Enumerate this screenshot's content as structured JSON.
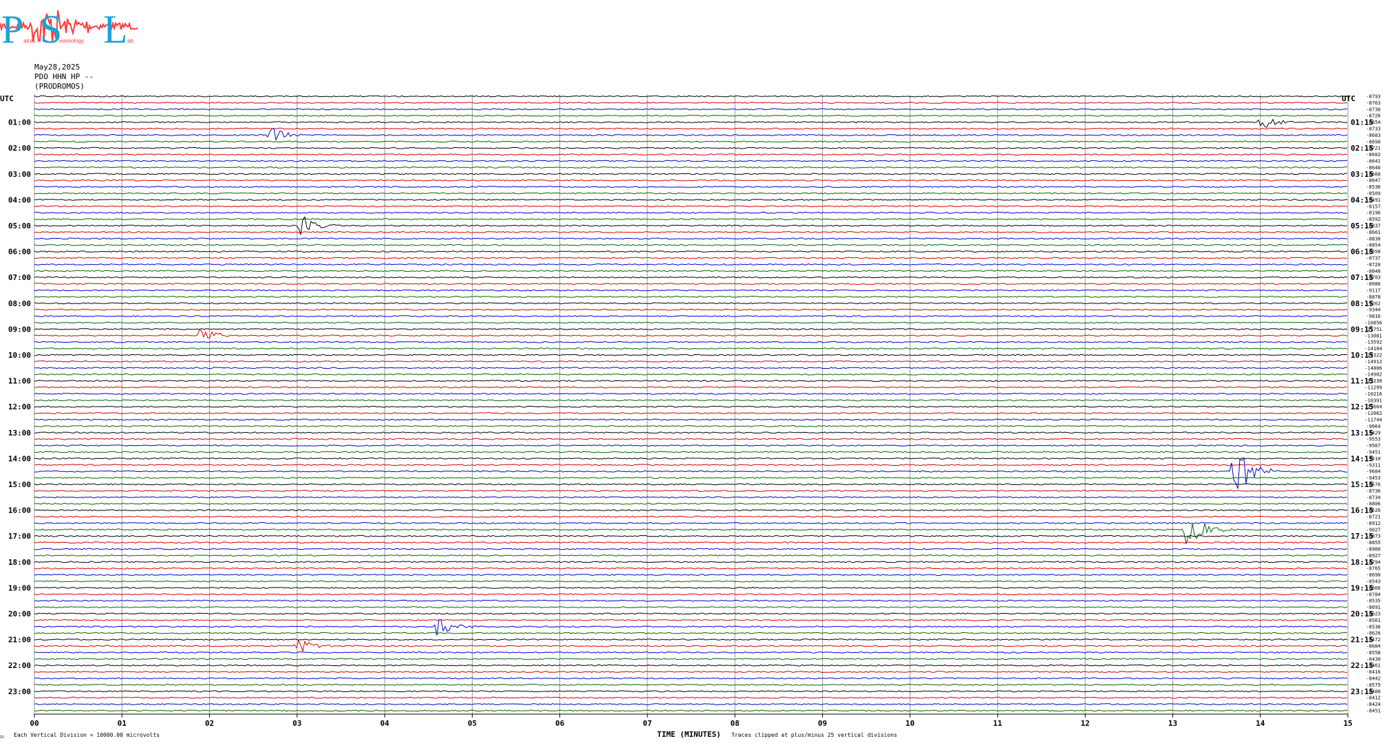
{
  "logo": {
    "letters": "PSL",
    "subtitle_a": "atras",
    "subtitle_b": "eismology",
    "subtitle_c": "ab",
    "colors": {
      "letters": "#19a3d6",
      "wave": "#ff3b3b"
    }
  },
  "header": {
    "date": "May28,2025",
    "station": "PDO HHN HP --",
    "location": "(PRODROMOS)"
  },
  "axis": {
    "utc_left": "UTC",
    "utc_right": "UTC",
    "xlabel": "TIME (MINUTES)",
    "footer_left": "Each Vertical Division = 10000.00 microvolts",
    "footer_right": "Traces clipped at plus/minus 25 vertical divisions",
    "corner_mark": "IS"
  },
  "chart_data": {
    "type": "line",
    "title": "",
    "xlabel": "TIME (MINUTES)",
    "ylabel": "UTC",
    "xlim": [
      0,
      15
    ],
    "x_ticks": [
      "00",
      "01",
      "02",
      "03",
      "04",
      "05",
      "06",
      "07",
      "08",
      "09",
      "10",
      "11",
      "12",
      "13",
      "14",
      "15"
    ],
    "left_hour_labels": [
      "01:00",
      "02:00",
      "03:00",
      "04:00",
      "05:00",
      "06:00",
      "07:00",
      "08:00",
      "09:00",
      "10:00",
      "11:00",
      "12:00",
      "13:00",
      "14:00",
      "15:00",
      "16:00",
      "17:00",
      "18:00",
      "19:00",
      "20:00",
      "21:00",
      "22:00",
      "23:00"
    ],
    "right_hour_labels": [
      "01:15",
      "02:15",
      "03:15",
      "04:15",
      "05:15",
      "06:15",
      "07:15",
      "08:15",
      "09:15",
      "10:15",
      "11:15",
      "12:15",
      "13:15",
      "14:15",
      "15:15",
      "16:15",
      "17:15",
      "18:15",
      "19:15",
      "20:15",
      "21:15",
      "22:15",
      "23:15"
    ],
    "trace_colors": [
      "#000000",
      "#d40000",
      "#0000cc",
      "#006600"
    ],
    "trace_offsets": [
      "-8793",
      "-8763",
      "-8730",
      "-8726",
      "-8654",
      "-8733",
      "-8683",
      "-8690",
      "-8721",
      "-8602",
      "-8641",
      "-8646",
      "-8660",
      "-8647",
      "-8536",
      "-8509",
      "-8491",
      "-8157",
      "-8196",
      "-8592",
      "-8837",
      "-8661",
      "-8830",
      "-8854",
      "-8558",
      "-8737",
      "-8720",
      "-8848",
      "-8703",
      "-8986",
      "-9117",
      "-8878",
      "-9262",
      "-9344",
      "-9816",
      "-10856",
      "-11751",
      "-13081",
      "-13592",
      "-14104",
      "-14322",
      "-14912",
      "-14806",
      "-14902",
      "-13230",
      "-11299",
      "-10216",
      "-10391",
      "-13664",
      "-12062",
      "-11744",
      "-9664",
      "-9429",
      "-9553",
      "-9567",
      "-9451",
      "-9510",
      "-9311",
      "-9684",
      "-9453",
      "-8576",
      "-8736",
      "-8734",
      "-8806",
      "-8526",
      "-8721",
      "-8912",
      "-9027",
      "-8873",
      "-8855",
      "-8980",
      "-8927",
      "-8794",
      "-8765",
      "-8690",
      "-8543",
      "-8666",
      "-8784",
      "-8535",
      "-8691",
      "-8623",
      "-8561",
      "-8536",
      "-8626",
      "-8472",
      "-8684",
      "-8558",
      "-8430",
      "-8461",
      "-8416",
      "-8442",
      "-8575",
      "-8488",
      "-8412",
      "-8424",
      "-8451"
    ],
    "events": [
      {
        "trace": 67,
        "minute": 13.15,
        "amplitude": 4,
        "color": "#006600"
      },
      {
        "trace": 58,
        "minute": 13.7,
        "amplitude": 5,
        "color": "#0000cc"
      },
      {
        "trace": 20,
        "minute": 3.05,
        "amplitude": 2,
        "color": "#000000"
      },
      {
        "trace": 82,
        "minute": 4.6,
        "amplitude": 2,
        "color": "#006600"
      },
      {
        "trace": 37,
        "minute": 1.9,
        "amplitude": 1.5,
        "color": "#d40000"
      },
      {
        "trace": 85,
        "minute": 3.0,
        "amplitude": 1.5,
        "color": "#d40000"
      },
      {
        "trace": 6,
        "minute": 2.7,
        "amplitude": 1.5,
        "color": "#0000cc"
      },
      {
        "trace": 4,
        "minute": 14.0,
        "amplitude": 1.5,
        "color": "#000000"
      }
    ]
  }
}
